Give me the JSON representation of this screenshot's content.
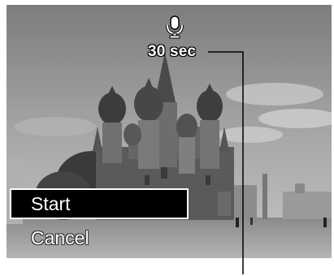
{
  "status": {
    "icon": "microphone-icon",
    "duration": "30 sec"
  },
  "menu": {
    "items": [
      {
        "label": "Start",
        "selected": true
      },
      {
        "label": "Cancel",
        "selected": false
      }
    ]
  }
}
